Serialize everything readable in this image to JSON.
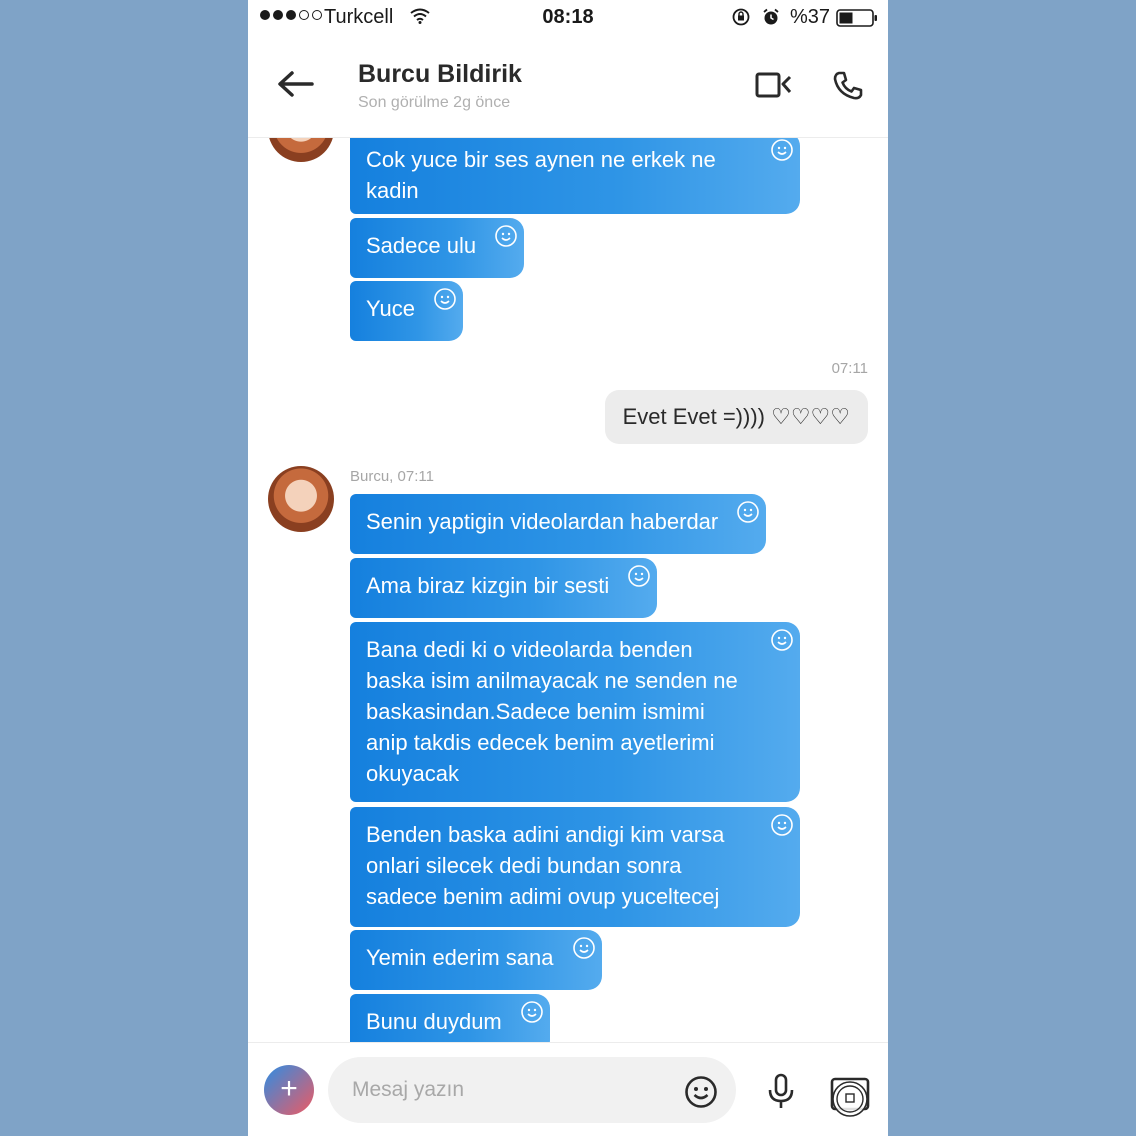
{
  "status_bar": {
    "carrier": "Turkcell",
    "time": "08:18",
    "battery": "%37"
  },
  "header": {
    "name": "Burcu Bildirik",
    "last_seen": "Son görülme 2g önce"
  },
  "messages": {
    "received_top": [
      "Cok yuce bir ses aynen ne erkek ne kadin",
      "Sadece ulu",
      "Yuce"
    ],
    "sent_time": "07:11",
    "sent_text": "Evet Evet =)))) ♡♡♡♡",
    "sender_label": "Burcu, 07:11",
    "received_bottom": [
      "Senin yaptigin videolardan haberdar",
      "Ama biraz kizgin bir sesti",
      "Bana dedi ki o videolarda benden baska isim anilmayacak ne senden ne baskasindan.Sadece benim ismimi anip takdis edecek benim ayetlerimi okuyacak",
      "Benden baska adini andigi kim varsa onlari silecek dedi bundan sonra sadece benim adimi ovup yuceltecej",
      "Yemin ederim sana",
      "Bunu duydum"
    ]
  },
  "input": {
    "placeholder": "Mesaj yazın"
  },
  "colors": {
    "background": "#7fa3c7",
    "bubble_received": "#1f88e0",
    "bubble_sent": "#ececec"
  }
}
